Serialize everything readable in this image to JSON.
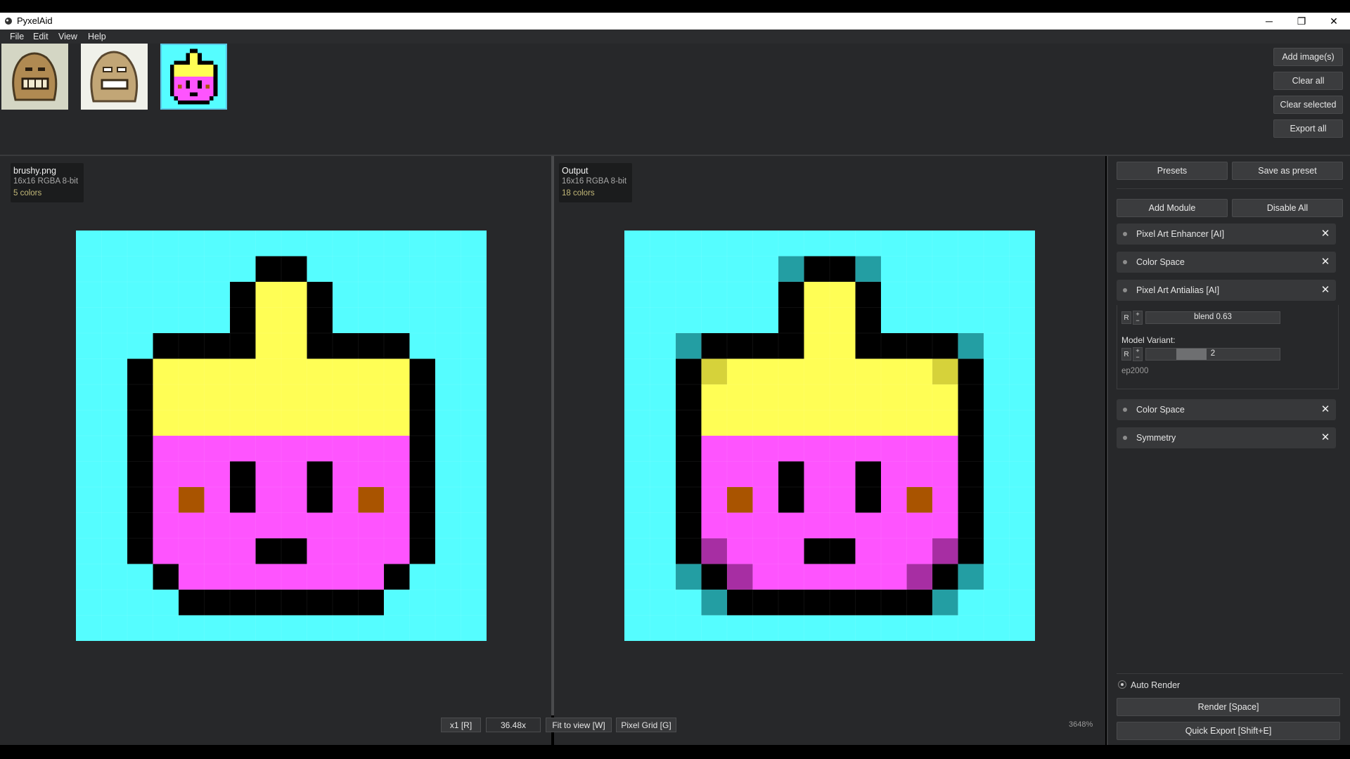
{
  "window": {
    "title": "PyxelAid",
    "minimize_glyph": "─",
    "restore_glyph": "❐",
    "close_glyph": "✕"
  },
  "menu": [
    "File",
    "Edit",
    "View",
    "Help"
  ],
  "thumbnails": [
    {
      "name": "golem-grin",
      "selected": false
    },
    {
      "name": "golem-frown",
      "selected": false
    },
    {
      "name": "brushy",
      "selected": true
    }
  ],
  "image_actions": {
    "add": "Add image(s)",
    "clear_all": "Clear all",
    "clear_selected": "Clear selected",
    "export_all": "Export all"
  },
  "input_info": {
    "filename": "brushy.png",
    "meta": "16x16  RGBA  8-bit",
    "colors": "5 colors"
  },
  "output_info": {
    "filename": "Output",
    "meta": "16x16  RGBA  8-bit",
    "colors": "18 colors"
  },
  "toolbar": {
    "x1": "x1 [R]",
    "zoom_value": "36.48x",
    "fit": "Fit to view [W]",
    "grid": "Pixel Grid [G]",
    "zoom_percent": "3648%"
  },
  "sidebar": {
    "presets": "Presets",
    "save_preset": "Save as preset",
    "add_module": "Add Module",
    "disable_all": "Disable All",
    "modules": [
      "Pixel Art Enhancer [AI]",
      "Color Space",
      "Pixel Art Antialias [AI]",
      "Color Space",
      "Symmetry"
    ],
    "antialias": {
      "reset": "R",
      "blend_label": "blend 0.63",
      "blend_value": 0.63,
      "variant_title": "Model Variant:",
      "variant_value": "2",
      "variant_level": 0.45,
      "variant_name": "ep2000"
    },
    "close_glyph": "✕",
    "auto_render": "Auto Render",
    "render": "Render  [Space]",
    "quick_export": "Quick Export  [Shift+E]"
  },
  "colors": {
    "cyan": "#55fdff",
    "black": "#000000",
    "yellow": "#fffe55",
    "magenta": "#fe54fe",
    "brown": "#a95400",
    "teal": "#239ea3",
    "olive": "#d6d23a",
    "purple": "#a72ea3"
  },
  "pixel_art": {
    "input": [
      "CCCCCCCCCCCCCCCC",
      "CCCCCCCKKCCCCCCC",
      "CCCCCCKYYKCCCCCC",
      "CCCCCCKYYKCCCCCC",
      "CCCKKKKYYKKKKCCC",
      "CCKYYYYYYYYYYKCC",
      "CCKYYYYYYYYYYKCC",
      "CCKYYYYYYYYYYKCC",
      "CCKMMMMMMMMMMKCC",
      "CCKMMMKMMKMMMKCC",
      "CCKMBMKMMKMBMKCC",
      "CCKMMMMMMMMMMKCC",
      "CCKMMMMKKMMMMKCC",
      "CCCKMMMMMMMMKCCC",
      "CCCCKKKKKKKKCCCC",
      "CCCCCCCCCCCCCCCC"
    ],
    "output": [
      "CCCCCCCCCCCCCCCC",
      "CCCCCCTKKTCCCCCC",
      "CCCCCCKYYKCCCCCC",
      "CCCCCCKYYKCCCCCC",
      "CCTKKKKYYKKKKTCC",
      "CCKOYYYYYYYYOKCC",
      "CCKYYYYYYYYYYKCC",
      "CCKYYYYYYYYYYKCC",
      "CCKMMMMMMMMMMKCC",
      "CCKMMMKMMKMMMKCC",
      "CCKMBMKMMKMBMKCC",
      "CCKMMMMMMMMMMKCC",
      "CCKPMMMKKMMMPKCC",
      "CCTKPMMMMMMPKTCC",
      "CCCTKKKKKKKKTCCC",
      "CCCCCCCCCCCCCCCC"
    ]
  }
}
